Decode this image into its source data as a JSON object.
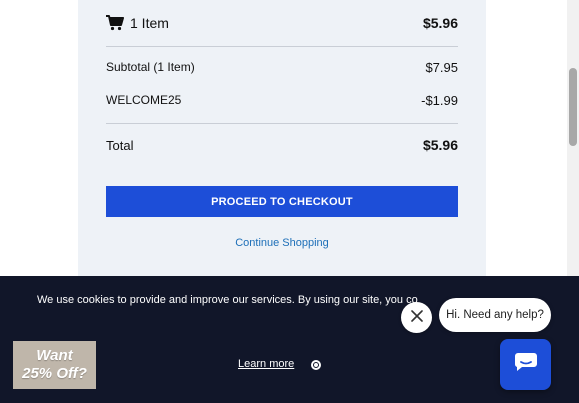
{
  "summary": {
    "items_label": "1 Item",
    "items_price": "$5.96",
    "subtotal_label": "Subtotal (1 Item)",
    "subtotal_value": "$7.95",
    "coupon_label": "WELCOME25",
    "coupon_value": "-$1.99",
    "total_label": "Total",
    "total_value": "$5.96"
  },
  "actions": {
    "checkout_label": "PROCEED TO CHECKOUT",
    "continue_label": "Continue Shopping"
  },
  "cookie": {
    "text": "We use cookies to provide and improve our services. By using our site, you co",
    "learn_more": "Learn more"
  },
  "promo": {
    "line1": "Want",
    "line2": "25% Off?"
  },
  "chat": {
    "bubble_text": "Hi. Need any help?"
  },
  "colors": {
    "accent": "#1d4ed8",
    "banner_bg": "#111629",
    "panel_bg": "#eef2f7",
    "link": "#1d6fb8"
  },
  "icons": [
    "cart-icon",
    "close-icon",
    "chat-icon",
    "radio-icon"
  ]
}
